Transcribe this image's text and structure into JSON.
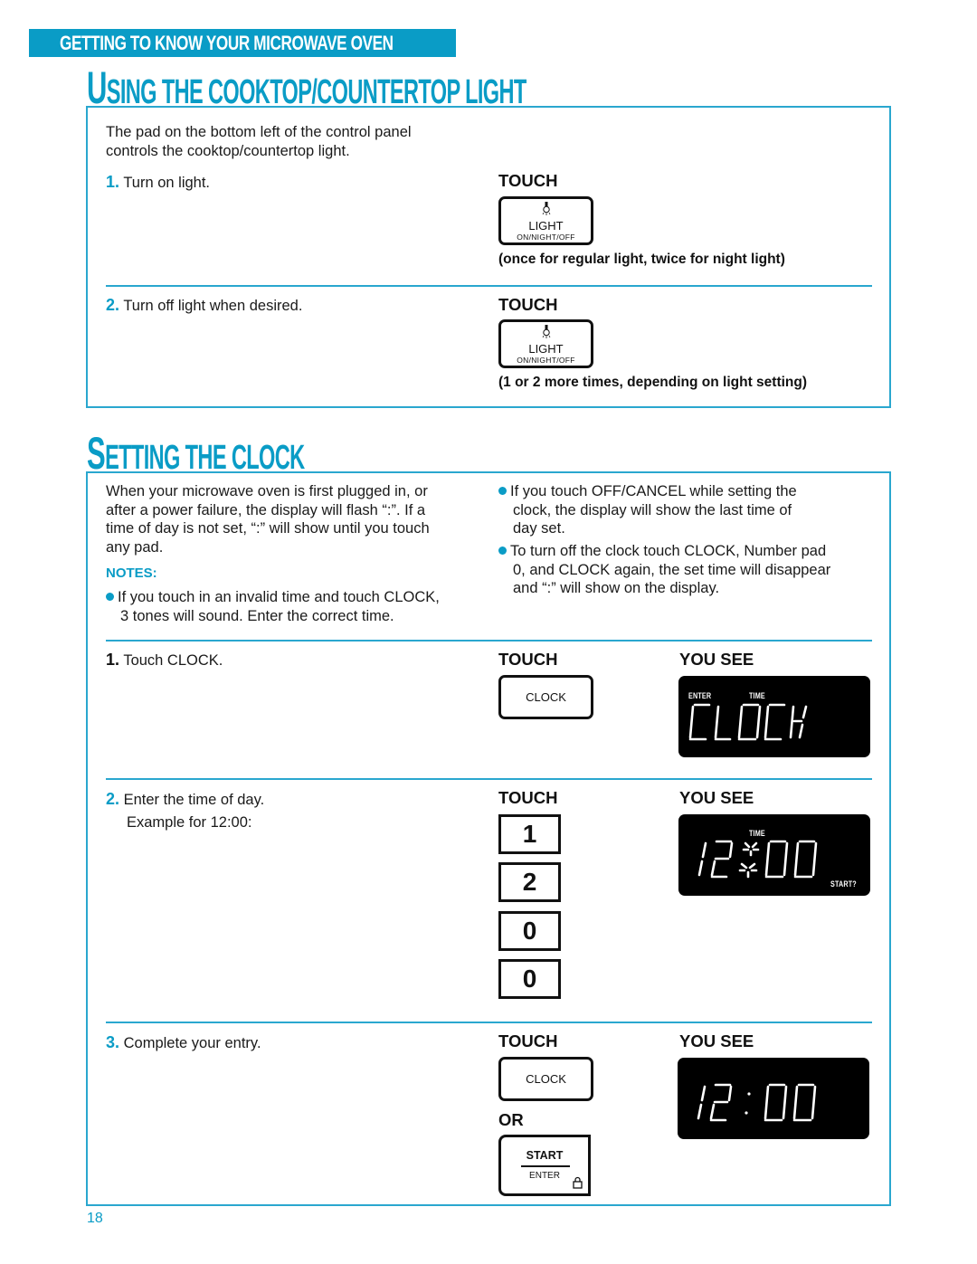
{
  "banner": {
    "label": "GETTING TO KNOW YOUR MICROWAVE OVEN"
  },
  "colors": {
    "accent": "#0a9cc6",
    "text": "#111111",
    "display_bg": "#000000",
    "display_fg": "#ffffff"
  },
  "light_section": {
    "title_first": "U",
    "title_rest": "SING THE COOKTOP/COUNTERTOP LIGHT",
    "intro": [
      "The pad on the bottom left of the control panel",
      "controls the cooktop/countertop light."
    ],
    "steps": [
      {
        "number": "1.",
        "text": "Turn on light.",
        "touch_label": "TOUCH",
        "pad": {
          "icon": "light-bulb-icon",
          "label": "LIGHT",
          "sublabel": "ON/NIGHT/OFF"
        },
        "note": "(once for regular light, twice for night light)"
      },
      {
        "number": "2.",
        "text": "Turn off light when desired.",
        "touch_label": "TOUCH",
        "pad": {
          "icon": "light-bulb-icon",
          "label": "LIGHT",
          "sublabel": "ON/NIGHT/OFF"
        },
        "note": "(1 or 2 more times, depending on light setting)"
      }
    ]
  },
  "clock_section": {
    "title_first": "S",
    "title_rest": "ETTING THE CLOCK",
    "intro": [
      "When your microwave oven is first plugged in, or",
      "after a power failure, the display will flash “:”. If a",
      "time of day is not set, “:” will show until you touch",
      "any pad."
    ],
    "notes_label": "NOTES:",
    "notes": [
      {
        "lines": [
          "If you touch in an invalid time and touch CLOCK,",
          "3 tones will sound. Enter the correct time."
        ]
      },
      {
        "lines": [
          "If you touch OFF/CANCEL while setting the",
          "clock, the display will show the last time of",
          "day set."
        ]
      },
      {
        "lines": [
          "To turn off the clock touch CLOCK, Number pad",
          "0, and CLOCK again, the set time will disappear",
          "and “:” will show on the display."
        ]
      }
    ],
    "steps": [
      {
        "number": "1.",
        "text": "Touch CLOCK.",
        "touch_label": "TOUCH",
        "you_see_label": "YOU SEE",
        "pad_label": "CLOCK",
        "display": {
          "indicators": [
            "ENTER",
            "TIME"
          ],
          "text": "CLOCK"
        }
      },
      {
        "number": "2.",
        "text": "Enter the time of day.",
        "subtext": "Example for 12:00:",
        "touch_label": "TOUCH",
        "you_see_label": "YOU SEE",
        "number_pads": [
          "1",
          "2",
          "0",
          "0"
        ],
        "display": {
          "indicators": [
            "TIME",
            "START?"
          ],
          "text": "12:00",
          "colon_flashing": true
        }
      },
      {
        "number": "3.",
        "text": "Complete your entry.",
        "touch_label": "TOUCH",
        "you_see_label": "YOU SEE",
        "pad_label": "CLOCK",
        "or_label": "OR",
        "start_pad": {
          "label": "START",
          "sublabel": "ENTER",
          "icon": "lock-icon"
        },
        "display": {
          "text": "12:00"
        }
      }
    ]
  },
  "page_number": "18"
}
